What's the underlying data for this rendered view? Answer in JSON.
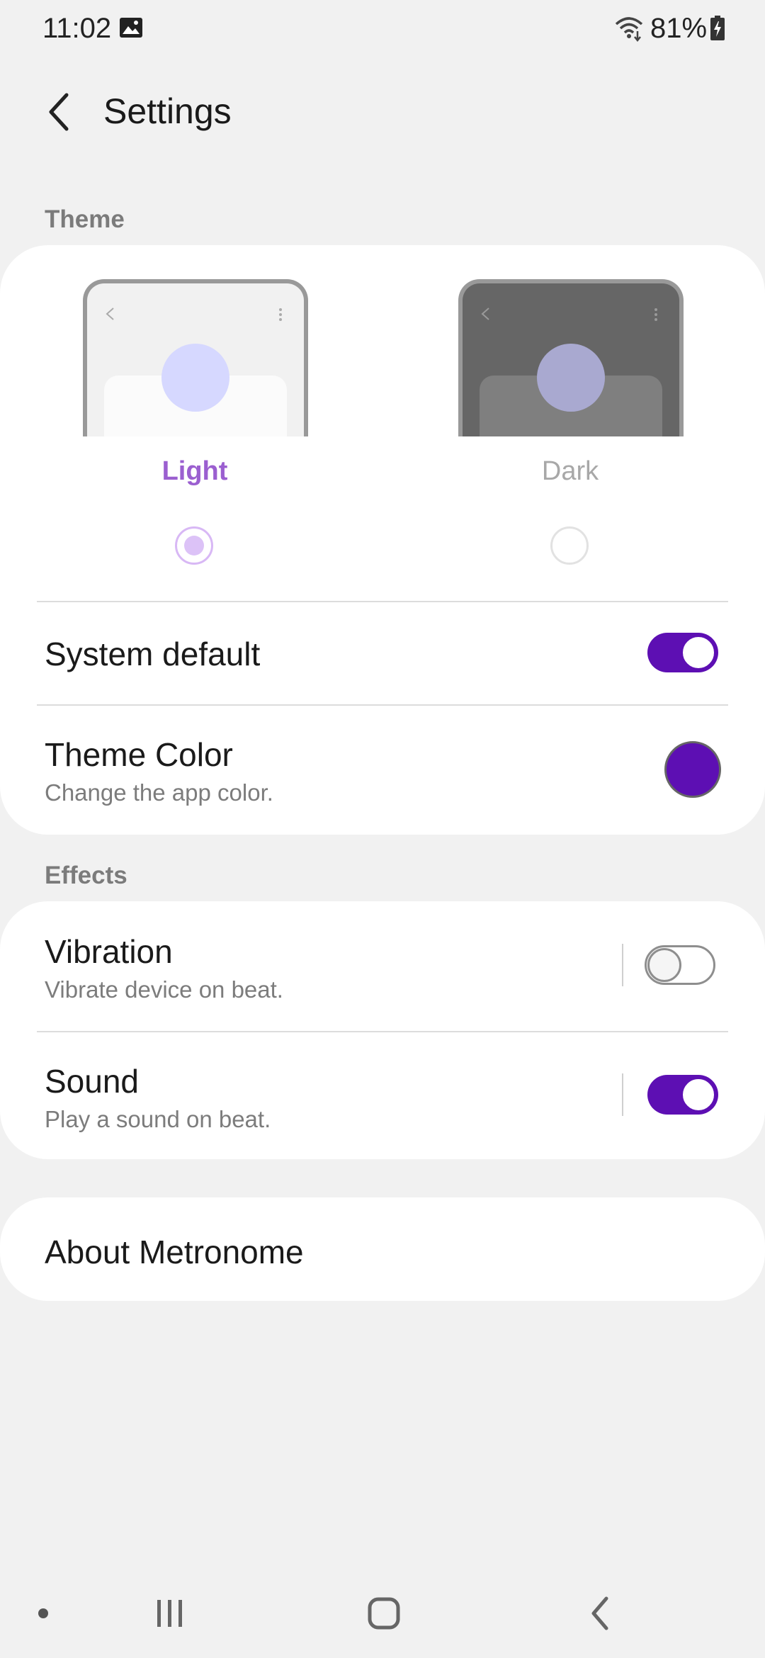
{
  "status_bar": {
    "time": "11:02",
    "battery": "81%",
    "icons": [
      "image-icon",
      "wifi-icon",
      "battery-charging-icon"
    ]
  },
  "header": {
    "title": "Settings",
    "back_icon": "chevron-left-icon"
  },
  "theme_section": {
    "label": "Theme",
    "options": [
      {
        "label": "Light",
        "selected": true
      },
      {
        "label": "Dark",
        "selected": false
      }
    ],
    "system_default": {
      "label": "System default",
      "enabled": true
    },
    "theme_color": {
      "label": "Theme Color",
      "sublabel": "Change the app color.",
      "color": "#5d0fb3"
    }
  },
  "effects_section": {
    "label": "Effects",
    "vibration": {
      "label": "Vibration",
      "sublabel": "Vibrate device on beat.",
      "enabled": false
    },
    "sound": {
      "label": "Sound",
      "sublabel": "Play a sound on beat.",
      "enabled": true
    }
  },
  "about": {
    "label": "About Metronome"
  },
  "colors": {
    "accent": "#5d0fb3",
    "selected_theme_label": "#9b5fd0",
    "background": "#f1f1f1"
  },
  "nav_bar": {
    "icons": [
      "recent-apps-icon",
      "home-icon",
      "back-icon"
    ]
  }
}
